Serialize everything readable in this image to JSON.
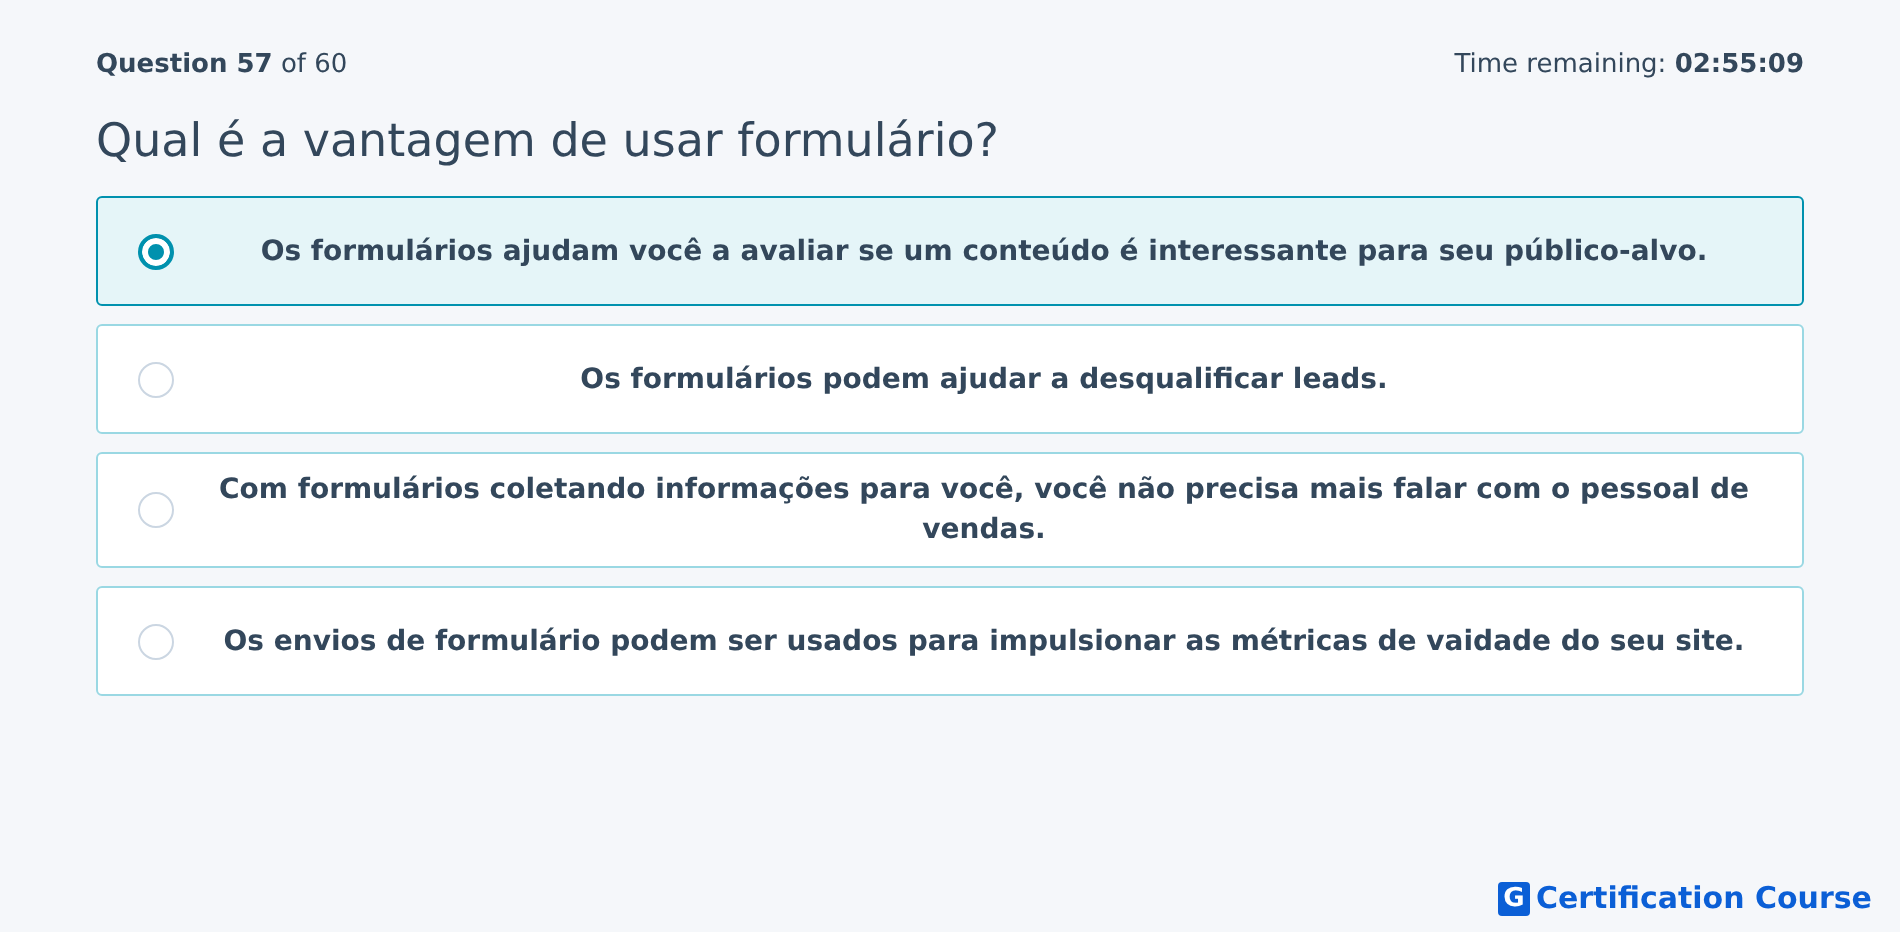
{
  "header": {
    "progress": "**Question 57** of 60",
    "timer": "Time remaining: **02:55:09**"
  },
  "question": "Qual é a vantagem de usar formulário?",
  "options": [
    {
      "label": "Os formulários ajudam você a avaliar se um conteúdo é interessante para seu público-alvo.",
      "selected": true
    },
    {
      "label": "Os formulários podem ajudar a desqualificar leads.",
      "selected": false
    },
    {
      "label": "Com formulários coletando informações para você, você não precisa mais falar com o pessoal de vendas.",
      "selected": false
    },
    {
      "label": "Os envios de formulário podem ser usados para impulsionar as métricas de vaidade do seu site.",
      "selected": false
    }
  ],
  "brand": {
    "mark": "G",
    "name": "Certification Course"
  }
}
